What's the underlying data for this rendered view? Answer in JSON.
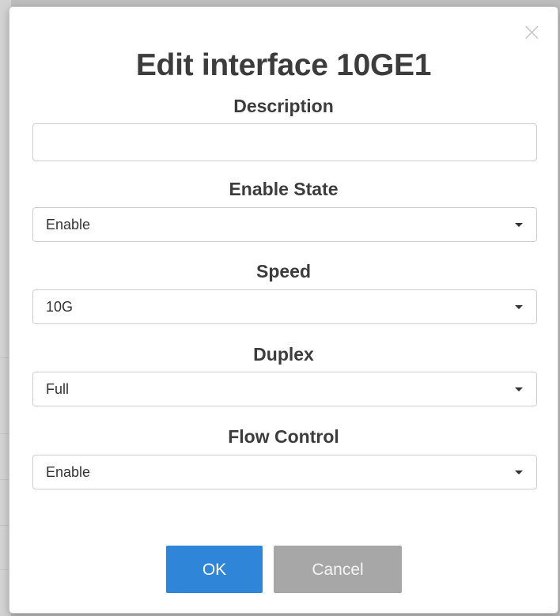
{
  "dialog": {
    "title": "Edit interface 10GE1",
    "close_symbol": "×",
    "close_icon": "close-icon"
  },
  "fields": {
    "description": {
      "label": "Description",
      "value": "",
      "placeholder": ""
    },
    "enable_state": {
      "label": "Enable State",
      "selected": "Enable"
    },
    "speed": {
      "label": "Speed",
      "selected": "10G"
    },
    "duplex": {
      "label": "Duplex",
      "selected": "Full"
    },
    "flow_control": {
      "label": "Flow Control",
      "selected": "Enable"
    }
  },
  "buttons": {
    "ok_label": "OK",
    "cancel_label": "Cancel"
  },
  "colors": {
    "primary": "#2f86d8",
    "secondary": "#a7a7a7",
    "text": "#3c3c3c",
    "overlay": "#bdbdbd"
  }
}
